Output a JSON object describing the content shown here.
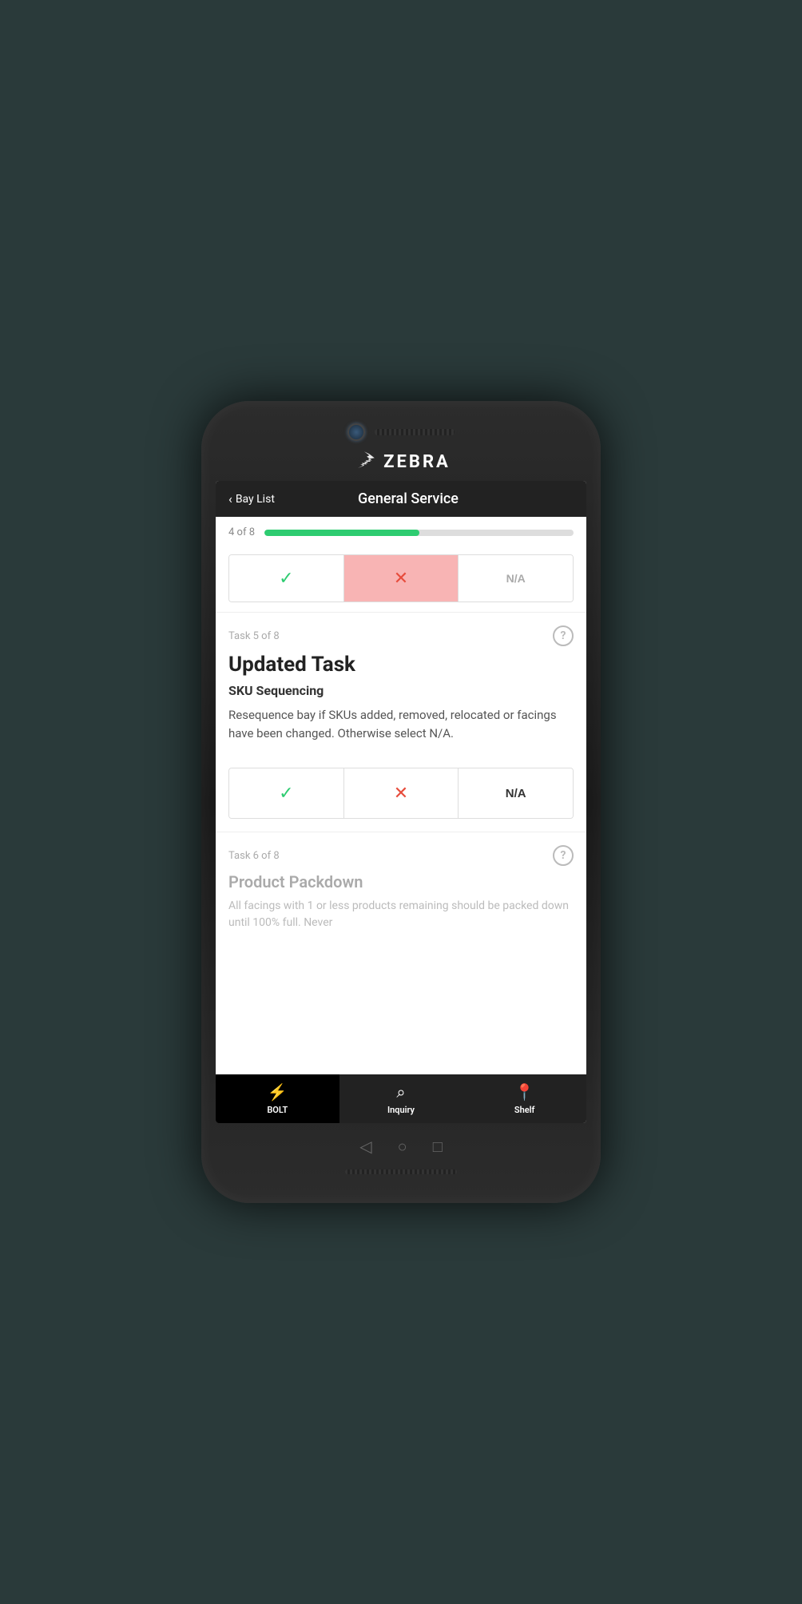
{
  "device": {
    "brand": "ZEBRA"
  },
  "header": {
    "back_label": "Bay List",
    "title": "General Service"
  },
  "progress": {
    "label": "4 of 8",
    "fill_percent": 50,
    "color": "#2ecc71"
  },
  "task4_toggle": {
    "check_label": "✓",
    "x_label": "✕",
    "na_label": "N/A",
    "active": "fail"
  },
  "task5": {
    "counter": "Task 5 of 8",
    "title": "Updated Task",
    "subtitle": "SKU Sequencing",
    "description": "Resequence bay if SKUs added, removed, relocated or facings have been changed. Otherwise select N/A.",
    "help_icon": "?"
  },
  "task5_toggle": {
    "check_label": "✓",
    "x_label": "✕",
    "na_label": "N/A"
  },
  "task6": {
    "counter": "Task 6 of 8",
    "title": "Product Packdown",
    "description": "All facings with 1 or less products remaining should be packed down until 100% full. Never",
    "help_icon": "?"
  },
  "bottom_nav": {
    "items": [
      {
        "label": "BOLT",
        "icon": "⚡",
        "active": true
      },
      {
        "label": "Inquiry",
        "icon": "🔍",
        "active": false
      },
      {
        "label": "Shelf",
        "icon": "📍",
        "active": false
      }
    ]
  },
  "android_nav": {
    "back": "◁",
    "home": "○",
    "recents": "□"
  }
}
